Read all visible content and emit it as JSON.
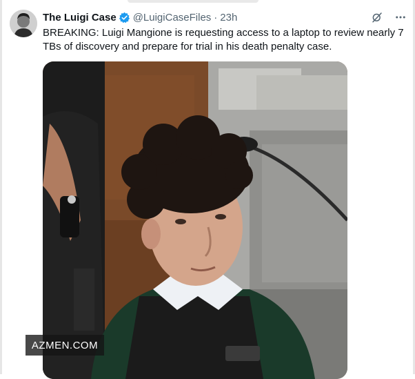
{
  "tweet": {
    "display_name": "The Luigi Case",
    "handle": "@LuigiCaseFiles",
    "separator": "·",
    "time": "23h",
    "text": "BREAKING: Luigi Mangione is requesting access to a laptop to review nearly 7 TBs of discovery and prepare for trial in his death penalty case.",
    "verified_color": "#1d9bf0",
    "icons": {
      "verified": "verified-badge-icon",
      "grok": "grok-icon",
      "more": "more-icon"
    }
  },
  "media": {
    "description_icon": "photo",
    "watermark": "AZMEN.COM"
  },
  "colors": {
    "text": "#0f1419",
    "secondary": "#536471",
    "accent": "#1d9bf0"
  }
}
